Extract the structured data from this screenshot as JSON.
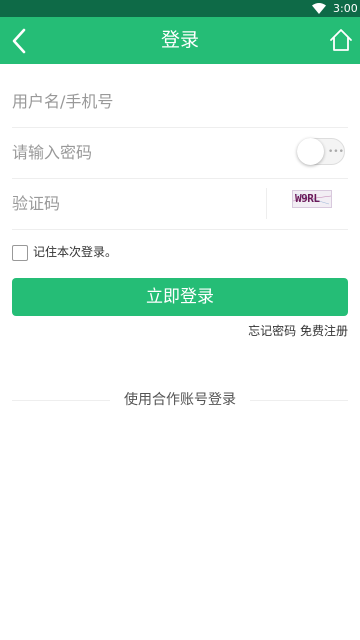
{
  "status_bar": {
    "time": "3:00"
  },
  "app_bar": {
    "title": "登录"
  },
  "form": {
    "username_placeholder": "用户名/手机号",
    "password_placeholder": "请输入密码",
    "captcha_placeholder": "验证码",
    "captcha_text": "W9RL",
    "password_visible": false,
    "remember_label": "记住本次登录。",
    "remember_checked": false,
    "login_button": "立即登录"
  },
  "links": {
    "forgot_password": "忘记密码",
    "register": "免费注册"
  },
  "partner_login": {
    "label": "使用合作账号登录"
  },
  "colors": {
    "status_bar": "#0e6a47",
    "primary": "#25bd76",
    "divider": "#eeeeee",
    "placeholder": "#999999"
  },
  "icons": {
    "back": "chevron-left-icon",
    "home": "home-icon",
    "wifi": "wifi-icon",
    "toggle": "password-visibility-toggle"
  }
}
